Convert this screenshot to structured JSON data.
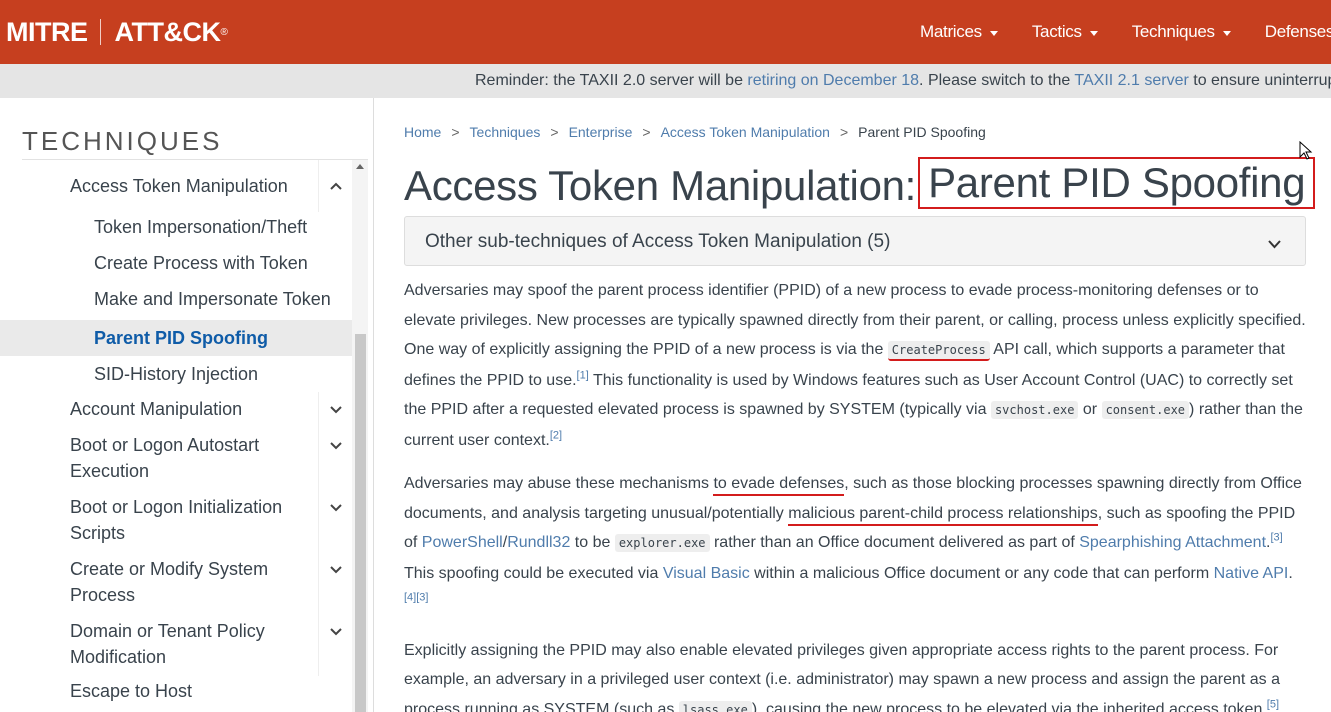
{
  "header": {
    "brand_left": "MITRE",
    "brand_right": "ATT&CK",
    "brand_mark": "®",
    "nav": [
      "Matrices",
      "Tactics",
      "Techniques",
      "Defenses"
    ]
  },
  "banner": {
    "text1": "Reminder: the TAXII 2.0 server will be ",
    "link1": "retiring on December 18",
    "text2": ". Please switch to the ",
    "link2": "TAXII 2.1 server",
    "text3": " to ensure uninterrupted"
  },
  "sidebar": {
    "title": "TECHNIQUES",
    "parent": "Access Token Manipulation",
    "subs": [
      "Token Impersonation/Theft",
      "Create Process with Token",
      "Make and Impersonate Token",
      "Parent PID Spoofing",
      "SID-History Injection"
    ],
    "items": [
      {
        "l1": "Account Manipulation"
      },
      {
        "l1": "Boot or Logon Autostart",
        "l2": "Execution"
      },
      {
        "l1": "Boot or Logon Initialization",
        "l2": "Scripts"
      },
      {
        "l1": "Create or Modify System",
        "l2": "Process"
      },
      {
        "l1": "Domain or Tenant Policy",
        "l2": "Modification"
      },
      {
        "l1": "Escape to Host"
      }
    ]
  },
  "breadcrumb": [
    "Home",
    "Techniques",
    "Enterprise",
    "Access Token Manipulation",
    "Parent PID Spoofing"
  ],
  "title": {
    "prefix": "Access Token Manipulation:",
    "highlight": "Parent PID Spoofing"
  },
  "accordion": {
    "label": "Other sub-techniques of Access Token Manipulation (5)"
  },
  "body": {
    "p1": {
      "t1": "Adversaries may spoof the parent process identifier (PPID) of a new process to evade process-monitoring defenses or to elevate privileges. New processes are typically spawned directly from their parent, or calling, process unless explicitly specified. One way of explicitly assigning the PPID of a new process is via the ",
      "c1": "CreateProcess",
      "t2": " API call, which supports a parameter that defines the PPID to use.",
      "r1": "[1]",
      "t3": " This functionality is used by Windows features such as User Account Control (UAC) to correctly set the PPID after a requested elevated process is spawned by SYSTEM (typically via ",
      "c2": "svchost.exe",
      "t4": " or ",
      "c3": "consent.exe",
      "t5": ") rather than the current user context.",
      "r2": "[2]"
    },
    "p2": {
      "t1": "Adversaries may abuse these mechanisms ",
      "u1": "to evade defenses",
      "t2": ", such as those blocking processes spawning directly from Office documents, and analysis targeting unusual/potentially ",
      "u2": "malicious parent-child process relationships",
      "t3": ", such as spoofing the PPID of ",
      "l1": "PowerShell",
      "t4": "/",
      "l2": "Rundll32",
      "t5": " to be ",
      "c1": "explorer.exe",
      "t6": " rather than an Office document delivered as part of ",
      "l3": "Spearphishing Attachment",
      "t7": ".",
      "r1": "[3]",
      "t8": " This spoofing could be executed via ",
      "l4": "Visual Basic",
      "t9": " within a malicious Office document or any code that can perform ",
      "l5": "Native API",
      "t10": ".",
      "r2": "[4][3]"
    },
    "p3": {
      "t1": "Explicitly assigning the PPID may also enable elevated privileges given appropriate access rights to the parent process. For example, an adversary in a privileged user context (i.e. administrator) may spawn a new process and assign the parent as a process running as SYSTEM (such as ",
      "c1": "lsass.exe",
      "t2": "), causing the new process to be elevated via the inherited access token.",
      "r1": "[5]"
    }
  }
}
